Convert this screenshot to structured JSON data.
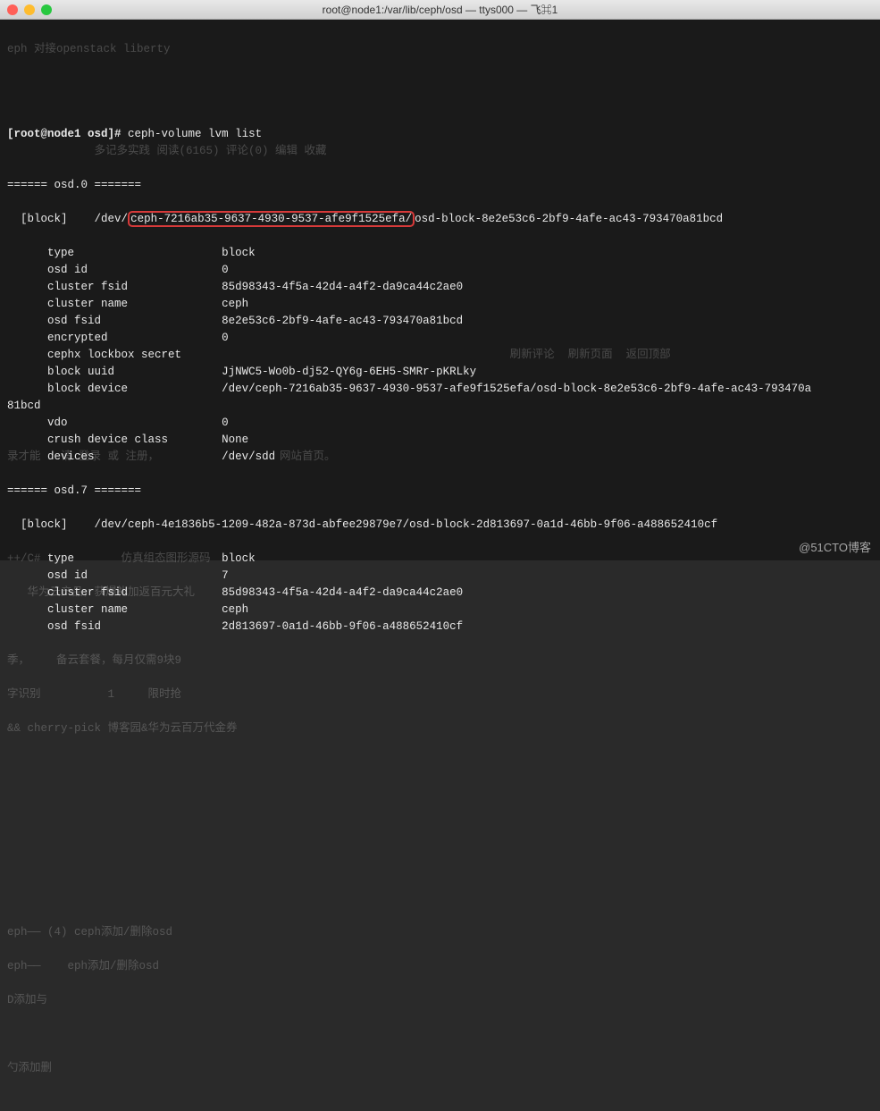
{
  "window": {
    "title": "root@node1:/var/lib/ceph/osd — ttys000 — 飞⌘1"
  },
  "prompt": {
    "user_host": "[root@node1 osd]#",
    "command": "ceph-volume lvm list"
  },
  "osd0": {
    "header": "====== osd.0 =======",
    "block_label": "[block]",
    "block_path_prefix": "/dev/",
    "block_path_highlight": "ceph-7216ab35-9637-4930-9537-afe9f1525efa/",
    "block_path_suffix": "osd-block-8e2e53c6-2bf9-4afe-ac43-793470a81bcd",
    "rows": {
      "type_label": "type",
      "type_value": "block",
      "osd_id_label": "osd id",
      "osd_id_value": "0",
      "cluster_fsid_label": "cluster fsid",
      "cluster_fsid_value": "85d98343-4f5a-42d4-a4f2-da9ca44c2ae0",
      "cluster_name_label": "cluster name",
      "cluster_name_value": "ceph",
      "osd_fsid_label": "osd fsid",
      "osd_fsid_value": "8e2e53c6-2bf9-4afe-ac43-793470a81bcd",
      "encrypted_label": "encrypted",
      "encrypted_value": "0",
      "cephx_label": "cephx lockbox secret",
      "cephx_value": "",
      "block_uuid_label": "block uuid",
      "block_uuid_value": "JjNWC5-Wo0b-dj52-QY6g-6EH5-SMRr-pKRLky",
      "block_device_label": "block device",
      "block_device_value": "/dev/ceph-7216ab35-9637-4930-9537-afe9f1525efa/osd-block-8e2e53c6-2bf9-4afe-ac43-793470a",
      "block_device_wrap": "81bcd",
      "vdo_label": "vdo",
      "vdo_value": "0",
      "crush_label": "crush device class",
      "crush_value": "None",
      "devices_label": "devices",
      "devices_value": "/dev/sdd"
    }
  },
  "osd7": {
    "header": "====== osd.7 =======",
    "block_label": "[block]",
    "block_path": "/dev/ceph-4e1836b5-1209-482a-873d-abfee29879e7/osd-block-2d813697-0a1d-46bb-9f06-a488652410cf",
    "rows": {
      "type_label": "type",
      "type_value": "block",
      "osd_id_label": "osd id",
      "osd_id_value": "7",
      "cluster_fsid_label": "cluster fsid",
      "cluster_fsid_value": "85d98343-4f5a-42d4-a4f2-da9ca44c2ae0",
      "cluster_name_label": "cluster name",
      "cluster_name_value": "ceph",
      "osd_fsid_label": "osd fsid",
      "osd_fsid_value": "2d813697-0a1d-46bb-9f06-a488652410cf"
    }
  },
  "ghost": {
    "g1": "eph 对接openstack liberty",
    "g2": "             多记多实践 阅读(6165) 评论(0) 编辑 收藏",
    "g3": "                                                                           刷新评论  刷新页面  返回顶部",
    "g4": "录才能   请 登录 或 注册，                  网站首页。",
    "g5": "++/C#            仿真组态图形源码",
    "g6": "   华为云产品，获爆礼加返百元大礼",
    "g7": "季，    备云套餐，每月仅需9块9",
    "g8": "字识别          1     限时抢",
    "g9": "&& cherry-pick 博客园&华为云百万代金券",
    "g10": "eph—— (4) ceph添加/删除osd",
    "g11": "eph——    eph添加/删除osd",
    "g12": "D添加与",
    "g13": "勺添加删"
  },
  "watermark": "@51CTO博客"
}
